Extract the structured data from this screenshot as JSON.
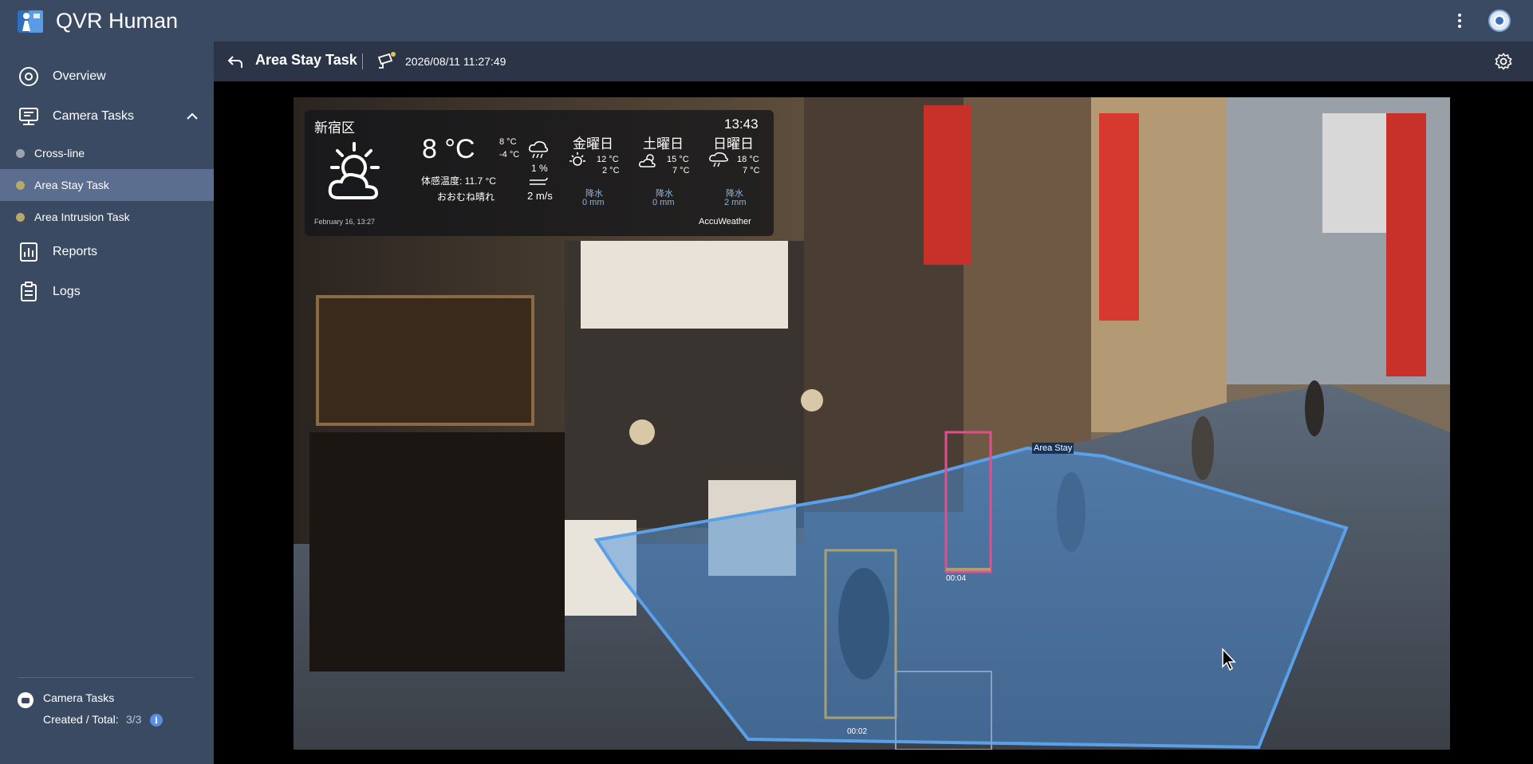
{
  "app": {
    "title": "QVR Human"
  },
  "sidebar": {
    "items": [
      {
        "label": "Overview",
        "icon": "overview-icon"
      },
      {
        "label": "Camera Tasks",
        "icon": "camera-tasks-icon"
      },
      {
        "label": "Reports",
        "icon": "reports-icon"
      },
      {
        "label": "Logs",
        "icon": "logs-icon"
      }
    ],
    "sub_items": [
      {
        "label": "Cross-line"
      },
      {
        "label": "Area Stay Task"
      },
      {
        "label": "Area Intrusion Task"
      }
    ],
    "footer": {
      "title": "Camera Tasks",
      "count_label": "Created / Total:",
      "count": "3/3"
    }
  },
  "header": {
    "title": "Area Stay Task",
    "timestamp": "2026/08/11 11:27:49"
  },
  "weather": {
    "location": "新宿区",
    "time": "13:43",
    "temp": "8 °C",
    "hi": "8 °C",
    "lo": "-4 °C",
    "feels_like": "体感温度: 11.7 °C",
    "condition": "おおむね晴れ",
    "rain_pct": "1 %",
    "wind": "2 m/s",
    "forecast": [
      {
        "day": "金曜日",
        "hi": "12 °C",
        "lo": "2 °C",
        "rain_label": "降水",
        "rain": "0 mm"
      },
      {
        "day": "土曜日",
        "hi": "15 °C",
        "lo": "7 °C",
        "rain_label": "降水",
        "rain": "0 mm"
      },
      {
        "day": "日曜日",
        "hi": "18 °C",
        "lo": "7 °C",
        "rain_label": "降水",
        "rain": "2 mm"
      }
    ],
    "updated": "February 16, 13:27",
    "brand": "AccuWeather"
  },
  "detection": {
    "zone_label": "Area Stay",
    "tracks": [
      {
        "time": "00:04"
      },
      {
        "time": "00:02"
      }
    ]
  },
  "colors": {
    "sidebar_bg": "#3b4a63",
    "header_bg": "#2b3547",
    "active_item": "#5b6e8f",
    "zone": "#4a90d9",
    "track_pink": "#e0508c",
    "track_olive": "#a8a070"
  }
}
